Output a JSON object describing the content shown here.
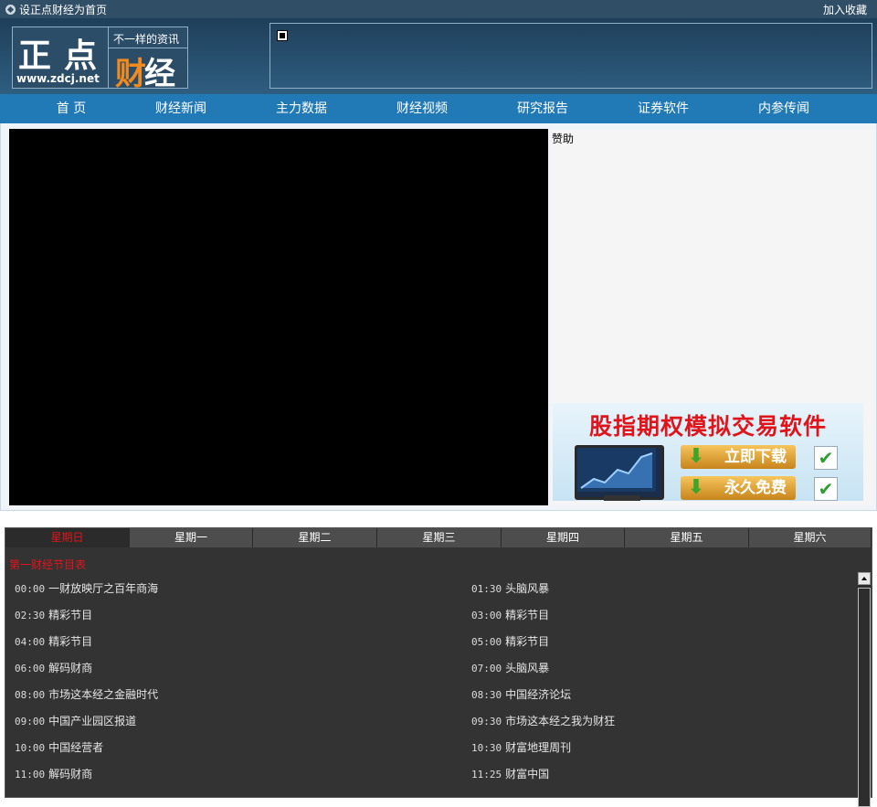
{
  "topbar": {
    "set_home": "设正点财经为首页",
    "add_favorite": "加入收藏"
  },
  "logo": {
    "big_text": "正点",
    "url": "www.zdcj.net",
    "slogan": "不一样的资讯",
    "brand_part1": "财",
    "brand_part2": "经"
  },
  "nav": {
    "items": [
      "首 页",
      "财经新闻",
      "主力数据",
      "财经视频",
      "研究报告",
      "证券软件",
      "内参传闻"
    ]
  },
  "sidebar": {
    "sponsor_label": "赞助",
    "promo": {
      "headline": "股指期权模拟交易软件",
      "download_label": "立即下载",
      "free_label": "永久免费"
    }
  },
  "schedule": {
    "tabs": [
      "星期日",
      "星期一",
      "星期二",
      "星期三",
      "星期四",
      "星期五",
      "星期六"
    ],
    "active_tab": "星期日",
    "title": "第一财经节目表",
    "programs": [
      {
        "time": "00:00",
        "name": "一财放映厅之百年商海"
      },
      {
        "time": "01:30",
        "name": "头脑风暴"
      },
      {
        "time": "02:30",
        "name": "精彩节目"
      },
      {
        "time": "03:00",
        "name": "精彩节目"
      },
      {
        "time": "04:00",
        "name": "精彩节目"
      },
      {
        "time": "05:00",
        "name": "精彩节目"
      },
      {
        "time": "06:00",
        "name": "解码财商"
      },
      {
        "time": "07:00",
        "name": "头脑风暴"
      },
      {
        "time": "08:00",
        "name": "市场这本经之金融时代"
      },
      {
        "time": "08:30",
        "name": "中国经济论坛"
      },
      {
        "time": "09:00",
        "name": "中国产业园区报道"
      },
      {
        "time": "09:30",
        "name": "市场这本经之我为财狂"
      },
      {
        "time": "10:00",
        "name": "中国经营者"
      },
      {
        "time": "10:30",
        "name": "财富地理周刊"
      },
      {
        "time": "11:00",
        "name": "解码财商"
      },
      {
        "time": "11:25",
        "name": "财富中国"
      }
    ]
  },
  "colors": {
    "nav_bg": "#2179b5",
    "topbar_bg": "#304e66",
    "active_tab_text": "#e0151b",
    "schedule_bg": "#333333"
  }
}
